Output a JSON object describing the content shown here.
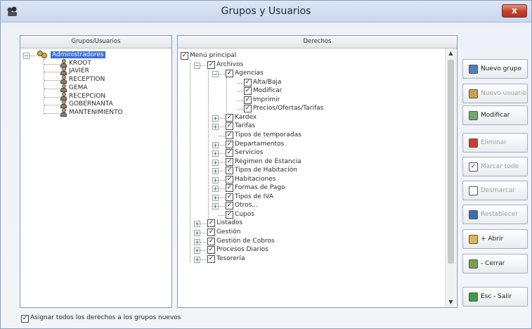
{
  "window": {
    "title": "Grupos y Usuarios",
    "close": "x"
  },
  "left_panel": {
    "header": "Grupos/Usuarios",
    "group": "Administradores",
    "users": [
      "KROOT",
      "JAVIER",
      "RECEPTION",
      "GEMA",
      "RECEPCION",
      "GOBERNANTA",
      "MANTENIMIENTO"
    ]
  },
  "right_panel": {
    "header": "Derechos",
    "tree": [
      {
        "label": "Menú principal",
        "level": 0,
        "checked": true,
        "expander": ""
      },
      {
        "label": "Archivos",
        "level": 1,
        "checked": true,
        "expander": "−"
      },
      {
        "label": "Agencias",
        "level": 2,
        "checked": true,
        "expander": "−"
      },
      {
        "label": "Alta/Baja",
        "level": 3,
        "checked": true,
        "expander": ""
      },
      {
        "label": "Modificar",
        "level": 3,
        "checked": true,
        "expander": ""
      },
      {
        "label": "Imprimir",
        "level": 3,
        "checked": true,
        "expander": ""
      },
      {
        "label": "Precios/Ofertas/Tarifas",
        "level": 3,
        "checked": true,
        "expander": ""
      },
      {
        "label": "Kardex",
        "level": 2,
        "checked": true,
        "expander": "+"
      },
      {
        "label": "Tarifas",
        "level": 2,
        "checked": true,
        "expander": "+"
      },
      {
        "label": "Tipos de temporadas",
        "level": 2,
        "checked": true,
        "expander": ""
      },
      {
        "label": "Departamentos",
        "level": 2,
        "checked": true,
        "expander": "+"
      },
      {
        "label": "Servicios",
        "level": 2,
        "checked": true,
        "expander": "+"
      },
      {
        "label": "Régimen de Estancia",
        "level": 2,
        "checked": true,
        "expander": "+"
      },
      {
        "label": "Tipos de Habitación",
        "level": 2,
        "checked": true,
        "expander": "+"
      },
      {
        "label": "Habitaciones",
        "level": 2,
        "checked": true,
        "expander": "+"
      },
      {
        "label": "Formas de Pago",
        "level": 2,
        "checked": true,
        "expander": "+"
      },
      {
        "label": "Tipos de IVA",
        "level": 2,
        "checked": true,
        "expander": "+"
      },
      {
        "label": "Otros...",
        "level": 2,
        "checked": true,
        "expander": "+"
      },
      {
        "label": "Cupos",
        "level": 2,
        "checked": true,
        "expander": ""
      },
      {
        "label": "Listados",
        "level": 1,
        "checked": true,
        "expander": "+"
      },
      {
        "label": "Gestión",
        "level": 1,
        "checked": true,
        "expander": "+"
      },
      {
        "label": "Gestión de Cobros",
        "level": 1,
        "checked": true,
        "expander": "+"
      },
      {
        "label": "Procesos Diarios",
        "level": 1,
        "checked": true,
        "expander": "+"
      },
      {
        "label": "Tesorería",
        "level": 1,
        "checked": true,
        "expander": "+"
      }
    ]
  },
  "buttons": [
    {
      "label": "Nuevo grupo",
      "icon": "users-icon",
      "enabled": true,
      "color": "#4a7fc1"
    },
    {
      "label": "Nuevo usuario",
      "icon": "user-icon",
      "enabled": false,
      "color": "#c9a24a"
    },
    {
      "label": "Modificar",
      "icon": "edit-icon",
      "enabled": true,
      "color": "#6fa86a"
    },
    {
      "label": "Eliminar",
      "icon": "delete-icon",
      "enabled": false,
      "color": "#d33b2c"
    },
    {
      "label": "Marcar todo",
      "icon": "check-all-icon",
      "enabled": false,
      "color": "#ffffff"
    },
    {
      "label": "Desmarcar",
      "icon": "uncheck-all-icon",
      "enabled": false,
      "color": "#ffffff"
    },
    {
      "label": "Restablecer",
      "icon": "restore-icon",
      "enabled": false,
      "color": "#3b6fb0"
    },
    {
      "label": "+ Abrir",
      "icon": "folder-open-icon",
      "enabled": true,
      "color": "#e0b645"
    },
    {
      "label": "- Cerrar",
      "icon": "folder-close-icon",
      "enabled": true,
      "color": "#7aa04e"
    },
    {
      "label": "Esc - Salir",
      "icon": "exit-icon",
      "enabled": true,
      "color": "#3aa046"
    }
  ],
  "footer": {
    "assign_all_label": "Asignar todos los derechos a los grupos nuevos",
    "assign_all_checked": true
  },
  "check_mark": "✓"
}
